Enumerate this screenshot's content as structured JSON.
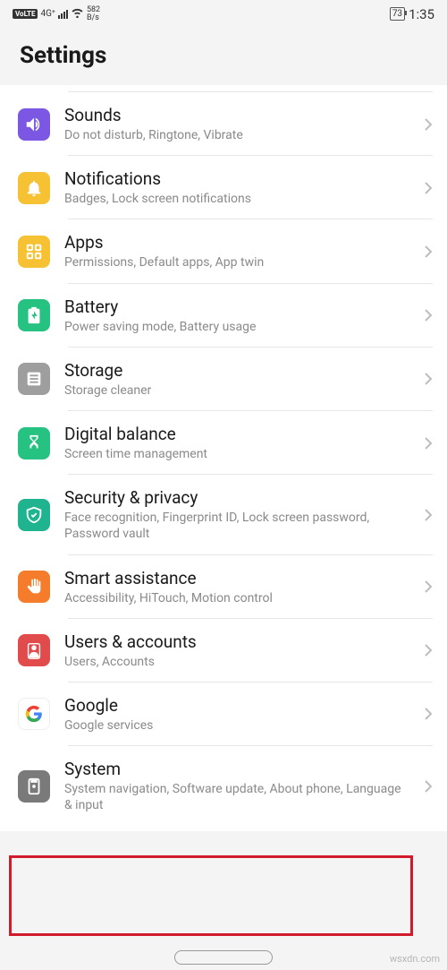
{
  "status": {
    "volte": "VoLTE",
    "net": "4G⁺",
    "speed_val": "582",
    "speed_unit": "B/s",
    "battery": "73",
    "time": "1:35"
  },
  "page": {
    "title": "Settings"
  },
  "items": [
    {
      "id": "sounds",
      "title": "Sounds",
      "sub": "Do not disturb, Ringtone, Vibrate"
    },
    {
      "id": "notifications",
      "title": "Notifications",
      "sub": "Badges, Lock screen notifications"
    },
    {
      "id": "apps",
      "title": "Apps",
      "sub": "Permissions, Default apps, App twin"
    },
    {
      "id": "battery",
      "title": "Battery",
      "sub": "Power saving mode, Battery usage"
    },
    {
      "id": "storage",
      "title": "Storage",
      "sub": "Storage cleaner"
    },
    {
      "id": "digital_balance",
      "title": "Digital balance",
      "sub": "Screen time management"
    },
    {
      "id": "security",
      "title": "Security & privacy",
      "sub": "Face recognition, Fingerprint ID, Lock screen password, Password vault"
    },
    {
      "id": "smart_assistance",
      "title": "Smart assistance",
      "sub": "Accessibility, HiTouch, Motion control"
    },
    {
      "id": "users",
      "title": "Users & accounts",
      "sub": "Users, Accounts"
    },
    {
      "id": "google",
      "title": "Google",
      "sub": "Google services"
    },
    {
      "id": "system",
      "title": "System",
      "sub": "System navigation, Software update, About phone, Language & input"
    }
  ],
  "watermark": "wsxdn.com"
}
